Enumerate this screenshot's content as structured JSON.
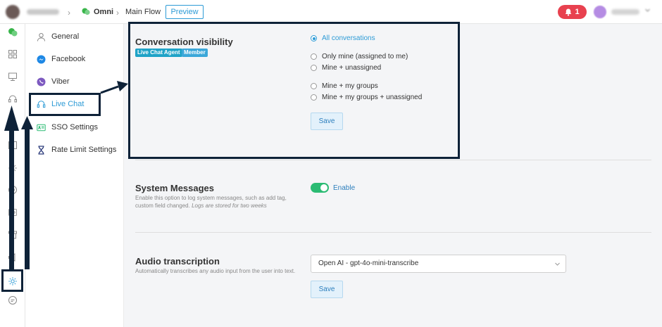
{
  "header": {
    "breadcrumb_omni": "Omni",
    "breadcrumb_flow": "Main Flow",
    "preview_label": "Preview",
    "notification_count": "1"
  },
  "subnav": {
    "items": [
      {
        "label": "General",
        "icon": "user-icon"
      },
      {
        "label": "Facebook",
        "icon": "messenger-icon"
      },
      {
        "label": "Viber",
        "icon": "viber-icon"
      },
      {
        "label": "Live Chat",
        "icon": "headset-icon",
        "active": true
      },
      {
        "label": "SSO Settings",
        "icon": "id-card-icon"
      },
      {
        "label": "Rate Limit Settings",
        "icon": "hourglass-icon"
      }
    ]
  },
  "visibility": {
    "title": "Conversation visibility",
    "badges": [
      "Live Chat Agent",
      "Member"
    ],
    "options": [
      "All conversations",
      "Only mine (assigned to me)",
      "Mine + unassigned",
      "Mine + my groups",
      "Mine + my groups + unassigned"
    ],
    "selected_index": 0,
    "save_label": "Save"
  },
  "system_messages": {
    "title": "System Messages",
    "description_plain": "Enable this option to log system messages, such as add tag, custom field changed.",
    "description_italic": "Logs are stored for two weeks",
    "toggle_label": "Enable",
    "enabled": true
  },
  "audio": {
    "title": "Audio transcription",
    "description": "Automatically transcribes any audio input from the user into text.",
    "selected_model": "Open AI - gpt-4o-mini-transcribe",
    "save_label": "Save"
  },
  "colors": {
    "accent": "#2d9bd6",
    "toggle_on": "#2bbb73",
    "notification": "#e8414f",
    "annotation": "#0e2238",
    "badge_agent": "#1fa3c7",
    "badge_member": "#3ba7d9"
  }
}
